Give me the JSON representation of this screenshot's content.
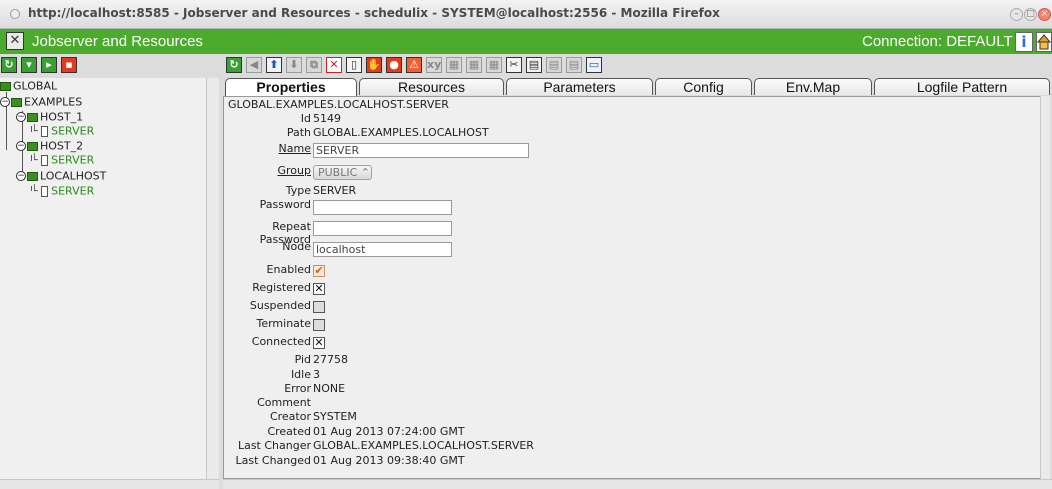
{
  "window": {
    "title": "http://localhost:8585 - Jobserver and Resources - schedulix - SYSTEM@localhost:2556 - Mozilla Firefox"
  },
  "app": {
    "title": "Jobserver and Resources",
    "connection": "Connection: DEFAULT",
    "info_glyph": "i"
  },
  "tree": {
    "nodes": [
      {
        "label": "GLOBAL"
      },
      {
        "label": "EXAMPLES"
      },
      {
        "label": "HOST_1"
      },
      {
        "label": "SERVER"
      },
      {
        "label": "HOST_2"
      },
      {
        "label": "SERVER"
      },
      {
        "label": "LOCALHOST"
      },
      {
        "label": "SERVER"
      }
    ]
  },
  "tabs": [
    {
      "label": "Properties"
    },
    {
      "label": "Resources"
    },
    {
      "label": "Parameters"
    },
    {
      "label": "Config"
    },
    {
      "label": "Env.Map"
    },
    {
      "label": "Logfile Pattern"
    }
  ],
  "form": {
    "header": "GLOBAL.EXAMPLES.LOCALHOST.SERVER",
    "id_label": "Id",
    "id": "5149",
    "path_label": "Path",
    "path": "GLOBAL.EXAMPLES.LOCALHOST",
    "name_label": "Name",
    "name": "SERVER",
    "group_label": "Group",
    "group": "PUBLIC ⌃",
    "type_label": "Type",
    "type": "SERVER",
    "password_label": "Password",
    "password": "",
    "repeat_password_label": "Repeat Password",
    "repeat_password": "",
    "node_label": "Node",
    "node": "localhost",
    "enabled_label": "Enabled",
    "enabled": true,
    "registered_label": "Registered",
    "registered": true,
    "suspended_label": "Suspended",
    "suspended": false,
    "terminate_label": "Terminate",
    "terminate": false,
    "connected_label": "Connected",
    "connected": true,
    "pid_label": "Pid",
    "pid": "27758",
    "idle_label": "Idle",
    "idle": "3",
    "error_label": "Error",
    "error": "NONE",
    "comment_label": "Comment",
    "comment": "",
    "creator_label": "Creator",
    "creator": "SYSTEM",
    "created_label": "Created",
    "created": "01 Aug 2013 07:24:00 GMT",
    "last_changer_label": "Last Changer",
    "last_changer": "GLOBAL.EXAMPLES.LOCALHOST.SERVER",
    "last_changed_label": "Last Changed",
    "last_changed": "01 Aug 2013 09:38:40 GMT"
  },
  "colors": {
    "app_header": "#4caa2c",
    "tree_leaf": "#2a8a1a",
    "accent_red": "#e43a1e"
  }
}
